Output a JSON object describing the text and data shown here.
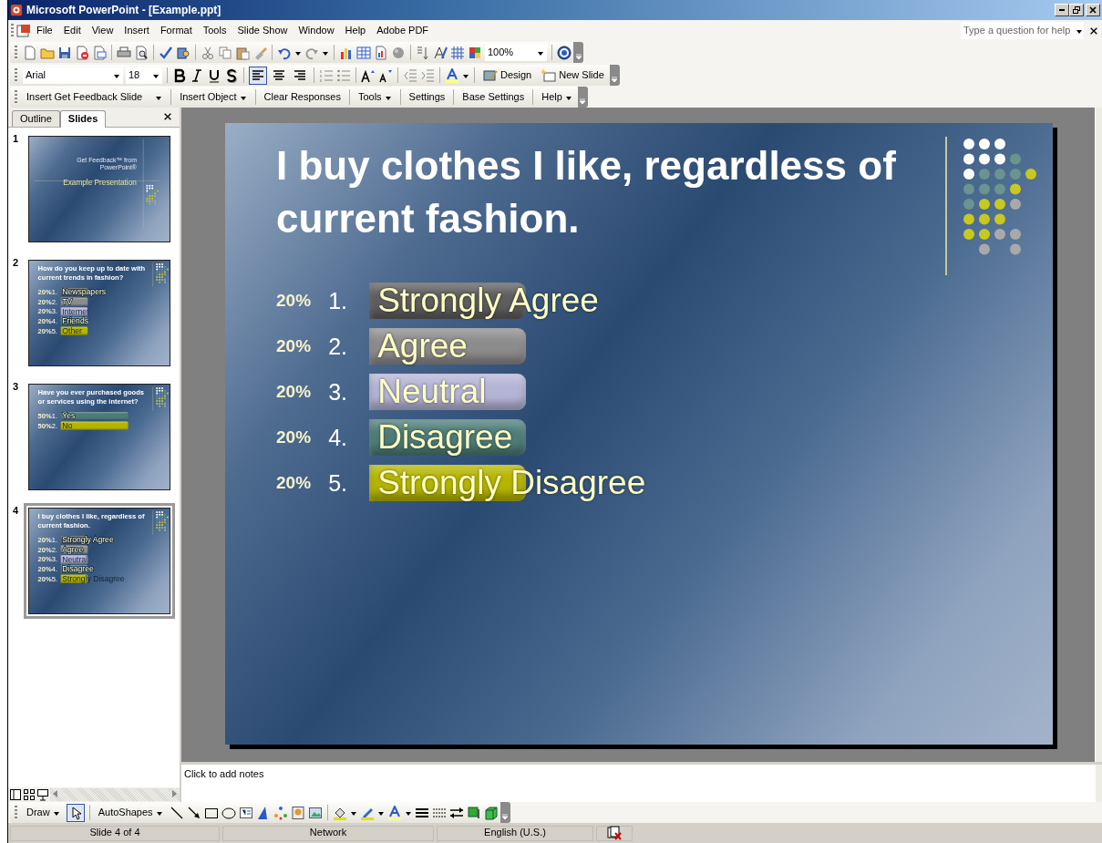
{
  "window": {
    "title": "Microsoft PowerPoint - [Example.ppt]"
  },
  "menu": [
    "File",
    "Edit",
    "View",
    "Insert",
    "Format",
    "Tools",
    "Slide Show",
    "Window",
    "Help",
    "Adobe PDF"
  ],
  "help_box": {
    "placeholder": "Type a question for help"
  },
  "standard_toolbar": {
    "zoom": "100%"
  },
  "formatting_toolbar": {
    "font": "Arial",
    "size": "18",
    "alignment": [
      {
        "selected": true
      },
      {
        "selected": false
      },
      {
        "selected": false
      }
    ],
    "buttons": [
      "Design",
      "New Slide"
    ]
  },
  "feedback_toolbar": [
    {
      "label": "Insert Get Feedback Slide",
      "dropdown": true
    },
    {
      "label": "Insert Object",
      "dropdown": true
    },
    {
      "label": "Clear Responses",
      "dropdown": false
    },
    {
      "label": "Tools",
      "dropdown": true
    },
    {
      "label": "Settings",
      "dropdown": false
    },
    {
      "label": "Base Settings",
      "dropdown": false
    },
    {
      "label": "Help",
      "dropdown": true
    }
  ],
  "pane_tabs": [
    {
      "label": "Outline",
      "selected": false
    },
    {
      "label": "Slides",
      "selected": true
    }
  ],
  "thumbnails": [
    {
      "number": "1",
      "selected": false,
      "slide": {
        "kind": "title",
        "title": "Get Feedback™ from PowerPoint®",
        "subtitle": "Example Presentation"
      }
    },
    {
      "number": "2",
      "selected": false,
      "slide": {
        "kind": "poll",
        "title": "How do you keep up to date with current trends in fashion?",
        "options": [
          {
            "percent": "20%",
            "number": "1.",
            "label": "Newspapers",
            "color": "#5e5e5e"
          },
          {
            "percent": "20%",
            "number": "2.",
            "label": "TV",
            "color": "#8c8c8c"
          },
          {
            "percent": "20%",
            "number": "3.",
            "label": "Internet",
            "color": "#b4b4d6"
          },
          {
            "percent": "20%",
            "number": "4.",
            "label": "Friends",
            "color": "#4d7c78"
          },
          {
            "percent": "20%",
            "number": "5.",
            "label": "Other",
            "color": "#b5b500"
          }
        ]
      }
    },
    {
      "number": "3",
      "selected": false,
      "slide": {
        "kind": "poll",
        "title": "Have you ever purchased goods or services using the internet?",
        "options": [
          {
            "percent": "50%",
            "number": "1.",
            "label": "Yes",
            "color": "#4d7c78"
          },
          {
            "percent": "50%",
            "number": "2.",
            "label": "No",
            "color": "#b5b500"
          }
        ]
      }
    },
    {
      "number": "4",
      "selected": true,
      "slide": {
        "kind": "poll",
        "title": "I buy clothes I like, regardless of current fashion.",
        "options": [
          {
            "percent": "20%",
            "number": "1.",
            "label": "Strongly Agree",
            "color": "#5e5e5e"
          },
          {
            "percent": "20%",
            "number": "2.",
            "label": "Agree",
            "color": "#8c8c8c"
          },
          {
            "percent": "20%",
            "number": "3.",
            "label": "Neutral",
            "color": "#b4b4d6"
          },
          {
            "percent": "20%",
            "number": "4.",
            "label": "Disagree",
            "color": "#4d7c78"
          },
          {
            "percent": "20%",
            "number": "5.",
            "label": "Strongly Disagree",
            "color": "#b5b500"
          }
        ]
      }
    }
  ],
  "slide": {
    "kind": "poll",
    "title": "I buy clothes I like, regardless of current fashion.",
    "options": [
      {
        "percent": "20%",
        "number": "1.",
        "label": "Strongly Agree",
        "color": "#5e5e5e"
      },
      {
        "percent": "20%",
        "number": "2.",
        "label": "Agree",
        "color": "#8c8c8c"
      },
      {
        "percent": "20%",
        "number": "3.",
        "label": "Neutral",
        "color": "#b4b4d6"
      },
      {
        "percent": "20%",
        "number": "4.",
        "label": "Disagree",
        "color": "#4d7c78"
      },
      {
        "percent": "20%",
        "number": "5.",
        "label": "Strongly Disagree",
        "color": "#b5b500"
      }
    ]
  },
  "notes": {
    "prompt": "Click to add notes"
  },
  "drawing_toolbar": {
    "draw": "Draw",
    "pointer_selected": true,
    "autoshapes": "AutoShapes"
  },
  "status_bar": [
    "Slide 4 of 4",
    "Network",
    "English (U.S.)"
  ]
}
